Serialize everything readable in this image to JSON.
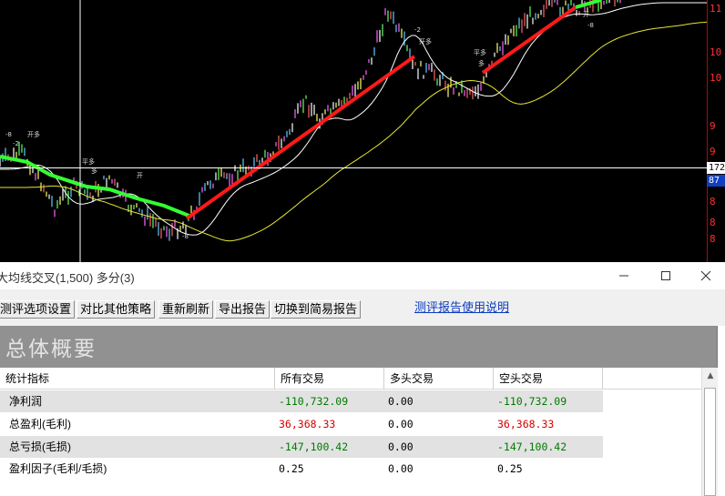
{
  "chart": {
    "price_ticks": [
      "11",
      "10",
      "10",
      "9",
      "9",
      "8",
      "8",
      "8"
    ],
    "price_tag_white": "172",
    "price_tag_blue": "87",
    "annotation_labels": [
      "-8",
      "-2",
      "开多",
      "平多",
      "多",
      "开"
    ],
    "colors": {
      "background": "#000000",
      "trend_up": "#ff1a1a",
      "trend_down": "#33ff33",
      "ma_fast": "#ffffff",
      "ma_slow": "#e6e633",
      "crosshair": "#ffffff",
      "axis": "#ff3030"
    }
  },
  "window": {
    "title": "大均线交叉(1,500) 多分(3)",
    "minimize_icon": "minimize-icon",
    "maximize_icon": "maximize-icon",
    "close_icon": "close-icon"
  },
  "toolbar": {
    "buttons": [
      "测评选项设置",
      "对比其他策略",
      "重新刷新",
      "导出报告",
      "切换到简易报告"
    ],
    "help_link": "测评报告使用说明"
  },
  "summary": {
    "title": "总体概要"
  },
  "table": {
    "headers": [
      "统计指标",
      "所有交易",
      "多头交易",
      "空头交易"
    ],
    "rows": [
      {
        "label": "净利润",
        "all": "-110,732.09",
        "long": "0.00",
        "short": "-110,732.09"
      },
      {
        "label": "总盈利(毛利)",
        "all": "36,368.33",
        "long": "0.00",
        "short": "36,368.33"
      },
      {
        "label": "总亏损(毛损)",
        "all": "-147,100.42",
        "long": "0.00",
        "short": "-147,100.42"
      },
      {
        "label": "盈利因子(毛利/毛损)",
        "all": "0.25",
        "long": "0.00",
        "short": "0.25"
      }
    ],
    "colors": {
      "negative": "#007a00",
      "positive": "#d40000",
      "neutral": "#000000"
    }
  }
}
